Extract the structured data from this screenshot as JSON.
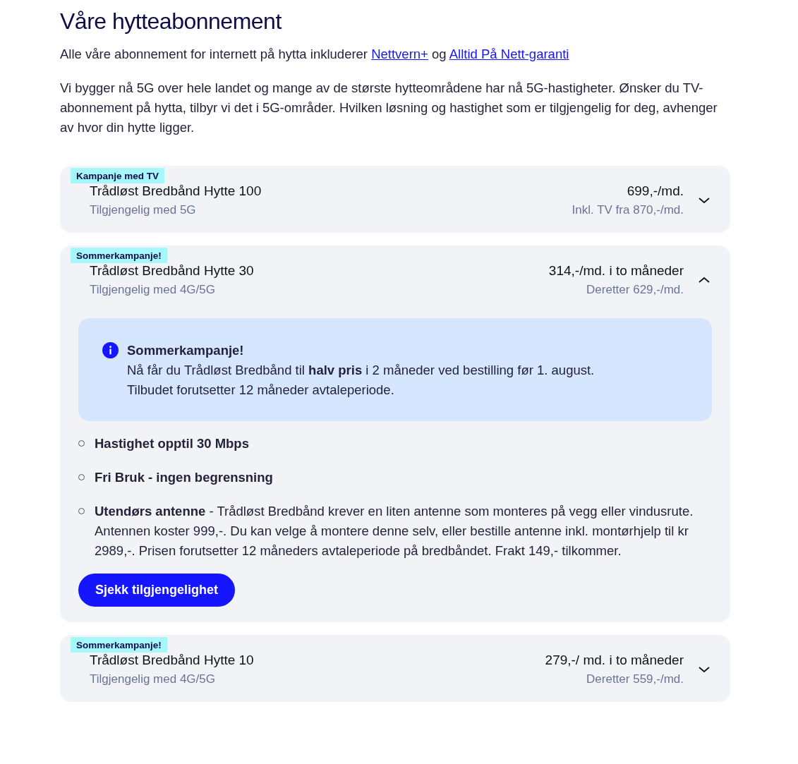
{
  "heading": "Våre hytteabonnement",
  "intro": [
    {
      "kind": "text",
      "text": "Alle våre abonnement for internett på hytta inkluderer"
    },
    {
      "kind": "link",
      "text": "Nettvern+"
    },
    {
      "kind": "text",
      "text": "og"
    },
    {
      "kind": "link",
      "text": "Alltid På Nett-garanti"
    }
  ],
  "description": "Vi bygger nå 5G over hele landet og mange av de største hytteområdene har nå 5G-hastigheter. Ønsker du TV-abonnement på hytta, tilbyr vi det i 5G-områder. Hvilken løsning og hastighet som er tilgjengelig for deg, avhenger av hvor din hytte ligger.",
  "plans": [
    {
      "badge": "Kampanje med TV",
      "name": "Trådløst Bredbånd Hytte 100",
      "availability": "Tilgjengelig med 5G",
      "price": "699,-/md.",
      "price_note": "Inkl. TV fra 870,-/md.",
      "expanded": false
    },
    {
      "badge": "Sommerkampanje!",
      "name": "Trådløst Bredbånd Hytte 30",
      "availability": "Tilgjengelig med 4G/5G",
      "price": "314,-/md. i to måneder",
      "price_note": "Deretter 629,-/md.",
      "expanded": true,
      "details": {
        "notice": {
          "title": "Sommerkampanje!",
          "text": "Nå får du Trådløst Bredbånd til **halv pris** i 2 måneder ved bestilling før 1. august.",
          "note": "Tilbudet forutsetter 12 måneder avtaleperiode."
        },
        "features": [
          {
            "text": "**Hastighet opptil 30 Mbps**"
          },
          {
            "text": "**Fri Bruk - ingen begrensning**"
          },
          {
            "text": "**Utendørs antenne** - Trådløst Bredbånd krever en liten antenne som monteres på vegg eller vindusrute. Antennen koster 999,-. Du kan velge å montere denne selv, eller bestille antenne inkl. montørhjelp til kr 2989,-. Prisen forutsetter 12 måneders avtaleperiode på bredbåndet. Frakt 149,- tilkommer."
          }
        ],
        "button": "Sjekk tilgjengelighet"
      }
    },
    {
      "badge": "Sommerkampanje!",
      "name": "Trådløst Bredbånd Hytte 10",
      "availability": "Tilgjengelig med 4G/5G",
      "price": "279,-/ md. i to måneder",
      "price_note": "Deretter 559,-/md.",
      "expanded": false
    }
  ]
}
